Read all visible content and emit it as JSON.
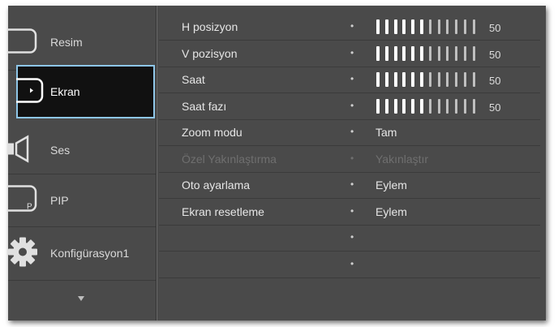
{
  "menu": {
    "items": [
      {
        "label": "Resim",
        "icon": "monitor-icon"
      },
      {
        "label": "Ekran",
        "icon": "screen-icon",
        "selected": true
      },
      {
        "label": "Ses",
        "icon": "speaker-icon"
      },
      {
        "label": "PIP",
        "icon": "pip-icon"
      },
      {
        "label": "Konfigürasyon1",
        "icon": "gear-icon"
      }
    ],
    "scroll_indicator": "chevron-down-icon"
  },
  "settings": {
    "rows": [
      {
        "label": "H posizyon",
        "type": "slider",
        "value": "50",
        "level": 0.5
      },
      {
        "label": "V pozisyon",
        "type": "slider",
        "value": "50",
        "level": 0.5
      },
      {
        "label": "Saat",
        "type": "slider",
        "value": "50",
        "level": 0.5
      },
      {
        "label": "Saat fazı",
        "type": "slider",
        "value": "50",
        "level": 0.5
      },
      {
        "label": "Zoom modu",
        "type": "text",
        "value": "Tam"
      },
      {
        "label": "Özel Yakınlaştırma",
        "type": "text",
        "value": "Yakınlaştır",
        "disabled": true
      },
      {
        "label": "Oto ayarlama",
        "type": "text",
        "value": "Eylem"
      },
      {
        "label": "Ekran resetleme",
        "type": "text",
        "value": "Eylem"
      },
      {
        "label": "",
        "type": "empty",
        "value": ""
      },
      {
        "label": "",
        "type": "empty",
        "value": ""
      }
    ]
  },
  "colors": {
    "panel": "#4a4a4a",
    "selected_bg": "#111111",
    "selected_border": "#8ec6e8",
    "text": "#e6e6e6",
    "disabled_text": "#6f6f6f"
  }
}
